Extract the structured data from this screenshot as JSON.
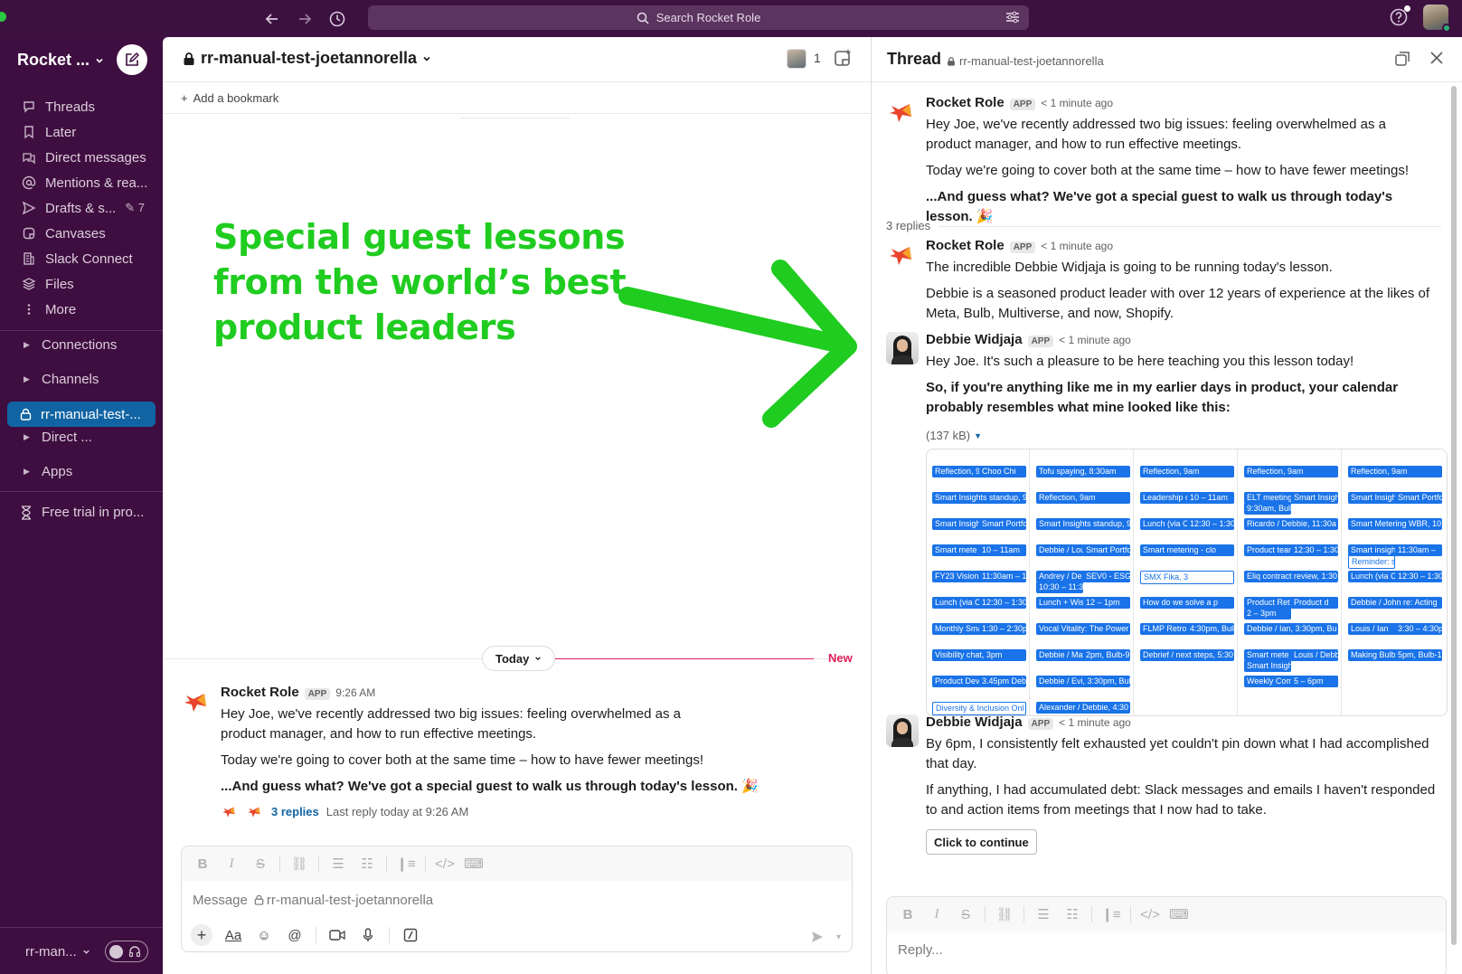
{
  "topbar": {
    "search_placeholder": "Search Rocket Role",
    "icons": [
      "back-arrow-icon",
      "forward-arrow-icon",
      "history-icon",
      "search-icon",
      "filter-icon",
      "help-icon"
    ]
  },
  "sidebar": {
    "workspace_name": "Rocket ...",
    "nav": [
      {
        "label": "Threads",
        "icon": "threads-icon"
      },
      {
        "label": "Later",
        "icon": "bookmark-icon"
      },
      {
        "label": "Direct messages",
        "icon": "dm-icon"
      },
      {
        "label": "Mentions & rea...",
        "icon": "at-icon"
      },
      {
        "label": "Drafts & s...",
        "icon": "send-icon",
        "count": "7"
      },
      {
        "label": "Canvases",
        "icon": "canvas-icon"
      },
      {
        "label": "Slack Connect",
        "icon": "building-icon"
      },
      {
        "label": "Files",
        "icon": "files-icon"
      },
      {
        "label": "More",
        "icon": "more-icon"
      }
    ],
    "sections": {
      "connections": "Connections",
      "channels": "Channels",
      "active_channel": "rr-manual-test-...",
      "direct": "Direct ...",
      "apps": "Apps"
    },
    "trial": "Free trial in pro...",
    "footer_workspace": "rr-man..."
  },
  "channel": {
    "name": "rr-manual-test-joetannorella",
    "member_count": "1",
    "add_bookmark": "Add a bookmark",
    "promo_text": "Special guest lessons from the world’s best product leaders",
    "today_label": "Today",
    "new_label": "New",
    "message": {
      "sender": "Rocket Role",
      "badge": "APP",
      "time": "9:26 AM",
      "p1": "Hey Joe, we've recently addressed two big issues: feeling overwhelmed as a product manager, and how to run effective meetings.",
      "p2": "Today we're going to cover both at the same time – how to have fewer meetings!",
      "p3": "...And guess what? We've got a special guest to walk us through today's lesson.",
      "p3_emoji": "🎉",
      "replies": "3 replies",
      "last_reply": "Last reply today at 9:26 AM"
    },
    "composer": {
      "placeholder_prefix": "Message",
      "placeholder_channel": "rr-manual-test-joetannorella"
    }
  },
  "thread": {
    "title": "Thread",
    "channel": "rr-manual-test-joetannorella",
    "parent": {
      "sender": "Rocket Role",
      "badge": "APP",
      "time": "< 1 minute ago",
      "p1": "Hey Joe, we've recently addressed two big issues: feeling overwhelmed as a product manager, and how to run effective meetings.",
      "p2": "Today we're going to cover both at the same time – how to have fewer meetings!",
      "p3": "...And guess what? We've got a special guest to walk us through today's lesson.",
      "p3_emoji": "🎉"
    },
    "replies_count": "3 replies",
    "reply1": {
      "sender": "Rocket Role",
      "badge": "APP",
      "time": "< 1 minute ago",
      "p1": "The incredible Debbie Widjaja is going to be running today's lesson.",
      "p2": "Debbie is a seasoned product leader with over 12 years of experience at the likes of Meta, Bulb, Multiverse, and now, Shopify."
    },
    "reply2": {
      "sender": "Debbie Widjaja",
      "badge": "APP",
      "time": "< 1 minute ago",
      "p1": "Hey Joe. It's such a pleasure to be here teaching you this lesson today!",
      "p2": "So, if you're anything like me in my earlier days in product, your calendar probably resembles what mine looked like this:",
      "attachment_size": "(137 kB)"
    },
    "reply3": {
      "sender": "Debbie Widjaja",
      "badge": "APP",
      "time": "< 1 minute ago",
      "p1": "By 6pm, I consistently felt exhausted yet couldn't pin down what I had accomplished that day.",
      "p2": "If anything, I had accumulated debt: Slack messages and emails I haven't responded to and action items from meetings that I now had to take.",
      "button": "Click to continue"
    },
    "composer_placeholder": "Reply..."
  },
  "calendar_events": [
    {
      "t": "Reflection, 9am",
      "col": 0,
      "row": 0
    },
    {
      "t": "Choo Chi",
      "col": 0,
      "row": 0
    },
    {
      "t": "Smart Insights standup, 9",
      "col": 0,
      "row": 1
    },
    {
      "t": "Smart Insigh",
      "col": 0,
      "row": 2
    },
    {
      "t": "Smart Portfo",
      "col": 0,
      "row": 2
    },
    {
      "t": "Smart mete",
      "col": 0,
      "row": 3
    },
    {
      "t": "10 – 11am",
      "col": 0,
      "row": 3
    },
    {
      "t": "FY23 Vision and Q1 Plan",
      "col": 0,
      "row": 4
    },
    {
      "t": "11:30am – 12:30pm",
      "col": 0,
      "row": 4
    },
    {
      "t": "Lunch (via Clockwise)",
      "col": 0,
      "row": 5
    },
    {
      "t": "12:30 – 1:30pm",
      "col": 0,
      "row": 5
    },
    {
      "t": "Monthly Smart Metering",
      "col": 0,
      "row": 6
    },
    {
      "t": "1:30 – 2:30pm",
      "col": 0,
      "row": 6
    },
    {
      "t": "Visibility chat, 3pm",
      "col": 0,
      "row": 7
    },
    {
      "t": "Product Dev",
      "col": 0,
      "row": 8
    },
    {
      "t": "3.45pm Debb",
      "col": 0,
      "row": 8
    },
    {
      "t": "Diversity & Inclusion Onl",
      "col": 0,
      "row": 9
    },
    {
      "t": "Tofu spaying, 8:30am",
      "col": 1,
      "row": 0
    },
    {
      "t": "Reflection, 9am",
      "col": 1,
      "row": 1
    },
    {
      "t": "Smart Insights standup, 9",
      "col": 1,
      "row": 2
    },
    {
      "t": "Debbie / Louis, 9",
      "col": 1,
      "row": 3
    },
    {
      "t": "Smart Portfo",
      "col": 1,
      "row": 3
    },
    {
      "t": "Andrey / De",
      "col": 1,
      "row": 4
    },
    {
      "t": "SEV0 - ESG",
      "col": 1,
      "row": 4
    },
    {
      "t": "10:30 – 11:30am",
      "col": 1,
      "row": 4
    },
    {
      "t": "Lunch + Wise video",
      "col": 1,
      "row": 5
    },
    {
      "t": "12 – 1pm",
      "col": 1,
      "row": 5
    },
    {
      "t": "Vocal Vitality: The Power",
      "col": 1,
      "row": 6
    },
    {
      "t": "Debbie / Matthew",
      "col": 1,
      "row": 7
    },
    {
      "t": "2pm, Bulb-9-Room 4 (6)",
      "col": 1,
      "row": 7
    },
    {
      "t": "Debbie / Evi, 3:30pm, Bul",
      "col": 1,
      "row": 8
    },
    {
      "t": "Alexander / Debbie, 4:30",
      "col": 1,
      "row": 9
    },
    {
      "t": "Reflection, 9am",
      "col": 2,
      "row": 0
    },
    {
      "t": "Leadership coaching",
      "col": 2,
      "row": 1
    },
    {
      "t": "10 – 11am",
      "col": 2,
      "row": 1
    },
    {
      "t": "Lunch (via Clockwise)",
      "col": 2,
      "row": 2
    },
    {
      "t": "12:30 – 1:30pm",
      "col": 2,
      "row": 2
    },
    {
      "t": "Smart metering - clo",
      "col": 2,
      "row": 3
    },
    {
      "t": "SMX Fika, 3",
      "col": 2,
      "row": 4
    },
    {
      "t": "How do we solve a p",
      "col": 2,
      "row": 5
    },
    {
      "t": "FLMP Retro",
      "col": 2,
      "row": 6
    },
    {
      "t": "4:30pm, Bulb-11-Room 1",
      "col": 2,
      "row": 6
    },
    {
      "t": "Debrief / next steps, 5:30",
      "col": 2,
      "row": 7
    },
    {
      "t": "Reflection, 9am",
      "col": 3,
      "row": 0
    },
    {
      "t": "ELT meeting",
      "col": 3,
      "row": 1
    },
    {
      "t": "Smart Insigh",
      "col": 3,
      "row": 1
    },
    {
      "t": "9:30am, Bulb-12-Boa",
      "col": 3,
      "row": 1
    },
    {
      "t": "Ricardo / Debbie, 11:30a",
      "col": 3,
      "row": 2
    },
    {
      "t": "Product team monthly lu",
      "col": 3,
      "row": 3
    },
    {
      "t": "12:30 – 1:30pm",
      "col": 3,
      "row": 3
    },
    {
      "t": "Eliq contract review, 1:30",
      "col": 3,
      "row": 4
    },
    {
      "t": "Product Ret",
      "col": 3,
      "row": 5
    },
    {
      "t": "Product d",
      "col": 3,
      "row": 5
    },
    {
      "t": "2 – 3pm",
      "col": 3,
      "row": 5
    },
    {
      "t": "Debbie / Ian, 3:30pm, Bu",
      "col": 3,
      "row": 6
    },
    {
      "t": "Smart mete",
      "col": 3,
      "row": 7
    },
    {
      "t": "Louis / Debb",
      "col": 3,
      "row": 7
    },
    {
      "t": "Smart Insigh",
      "col": 3,
      "row": 7
    },
    {
      "t": "Weekly Company Meetin",
      "col": 3,
      "row": 8
    },
    {
      "t": "5 – 6pm",
      "col": 3,
      "row": 8
    },
    {
      "t": "Reflection, 9am",
      "col": 4,
      "row": 0
    },
    {
      "t": "Smart Insights standup, 9",
      "col": 4,
      "row": 1
    },
    {
      "t": "Smart Portfolio Health Sta",
      "col": 4,
      "row": 1
    },
    {
      "t": "Smart Metering WBR, 10",
      "col": 4,
      "row": 2
    },
    {
      "t": "Smart insights Resea",
      "col": 4,
      "row": 3
    },
    {
      "t": "11:30am –",
      "col": 4,
      "row": 3
    },
    {
      "t": "Reminder: s",
      "col": 4,
      "row": 3
    },
    {
      "t": "Lunch (via Clockwise)",
      "col": 4,
      "row": 4
    },
    {
      "t": "12:30 – 1:30pm",
      "col": 4,
      "row": 4
    },
    {
      "t": "Debbie / John re: Acting",
      "col": 4,
      "row": 5
    },
    {
      "t": "Louis / Ian",
      "col": 4,
      "row": 6
    },
    {
      "t": "3:30 – 4:30pm",
      "col": 4,
      "row": 6
    },
    {
      "t": "Making Bulb",
      "col": 4,
      "row": 7
    },
    {
      "t": "5pm, Bulb-12-Event Spac",
      "col": 4,
      "row": 7
    }
  ],
  "colors": {
    "sidebar_bg": "#3f0e40",
    "active_channel": "#1164a3",
    "promo_green": "#1fcc1f",
    "new_red": "#e01e5a",
    "link_blue": "#1264a3",
    "calendar_event": "#1a73e8"
  }
}
